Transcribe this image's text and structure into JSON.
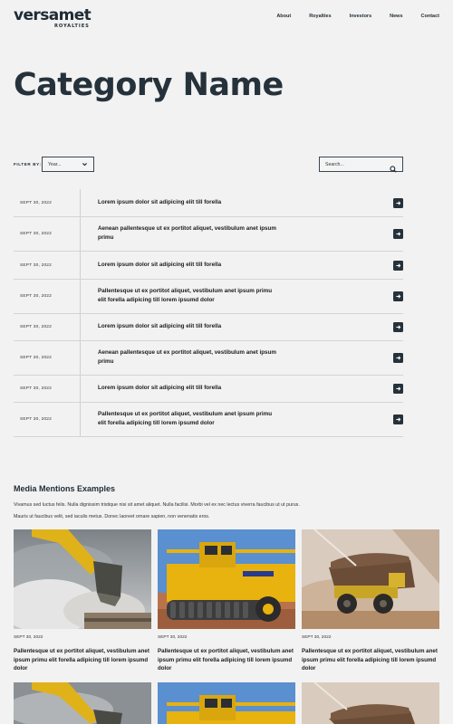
{
  "brand": {
    "name": "versamet",
    "tagline": "ROYALTIES"
  },
  "nav": {
    "items": [
      "About",
      "Royalties",
      "Investors",
      "News",
      "Contact"
    ]
  },
  "page": {
    "title": "Category Name"
  },
  "filter": {
    "label": "FILTER BY:",
    "year_value": "Year...",
    "search_placeholder": "Search..."
  },
  "articles": [
    {
      "date": "SEPT 30, 2022",
      "title": "Lorem ipsum dolor sit adipicing elit till forella"
    },
    {
      "date": "SEPT 30, 2022",
      "title": "Aenean pallentesque ut ex portitot aliquet, vestibulum anet ipsum primu"
    },
    {
      "date": "SEPT 30, 2022",
      "title": "Lorem ipsum dolor sit adipicing elit till forella"
    },
    {
      "date": "SEPT 30, 2022",
      "title": "Pallentesque ut ex portitot aliquet, vestibulum anet ipsum primu elit forella adipicing till lorem ipsumd dolor"
    },
    {
      "date": "SEPT 30, 2022",
      "title": "Lorem ipsum dolor sit adipicing elit till forella"
    },
    {
      "date": "SEPT 30, 2022",
      "title": "Aenean pallentesque ut ex portitot aliquet, vestibulum anet ipsum primu"
    },
    {
      "date": "SEPT 30, 2022",
      "title": "Lorem ipsum dolor sit adipicing elit till forella"
    },
    {
      "date": "SEPT 30, 2022",
      "title": "Pallentesque ut ex portitot aliquet, vestibulum anet ipsum primu elit forella adipicing till lorem ipsumd dolor"
    }
  ],
  "media": {
    "title": "Media Mentions Examples",
    "description": "Vivamus sed luctus felis. Nulla dignissim tristique nisi sit amet aliquet. Nulla facilisi. Morbi vel ex nec lectus viverra faucibus ut ut purus. Mauris ut faucibus velit, sed iaculis metus. Donec laoreet ornare sapien, non venenatis eros.",
    "cards": [
      {
        "date": "SEPT 30, 2022",
        "title": "Pallentesque ut ex portitot aliquet, vestibulum anet ipsum primu elit forella adipicing till lorem ipsumd dolor",
        "image": "excavator-photo"
      },
      {
        "date": "SEPT 30, 2022",
        "title": "Pallentesque ut ex portitot aliquet, vestibulum anet ipsum primu elit forella adipicing till lorem ipsumd dolor",
        "image": "mining-machine-photo"
      },
      {
        "date": "SEPT 30, 2022",
        "title": "Pallentesque ut ex portitot aliquet, vestibulum anet ipsum primu elit forella adipicing till lorem ipsumd dolor",
        "image": "haul-truck-photo"
      }
    ]
  },
  "colors": {
    "accent": "#26323b",
    "background": "#f2f2f2",
    "machine_yellow": "#e8b20f"
  }
}
